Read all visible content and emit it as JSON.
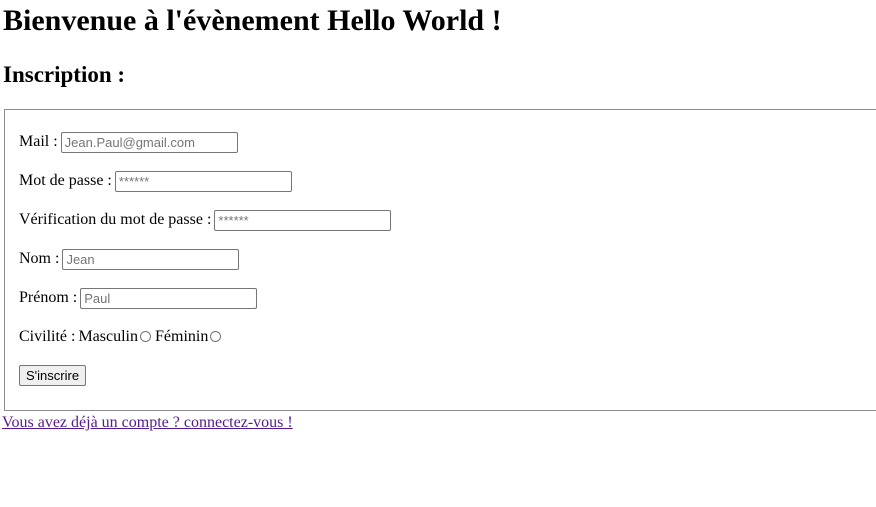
{
  "page": {
    "title": "Bienvenue à l'évènement Hello World !",
    "subtitle": "Inscription :"
  },
  "form": {
    "mail": {
      "label": "Mail :",
      "placeholder": "Jean.Paul@gmail.com"
    },
    "password": {
      "label": "Mot de passe :",
      "placeholder": "******"
    },
    "password_confirm": {
      "label": "Vérification du mot de passe :",
      "placeholder": "******"
    },
    "last_name": {
      "label": "Nom :",
      "placeholder": "Jean"
    },
    "first_name": {
      "label": "Prénom :",
      "placeholder": "Paul"
    },
    "civility": {
      "label": "Civilité :",
      "options": [
        "Masculin",
        "Féminin"
      ]
    },
    "submit_label": "S'inscrire"
  },
  "login_link": "Vous avez déjà un compte ? connectez-vous !"
}
